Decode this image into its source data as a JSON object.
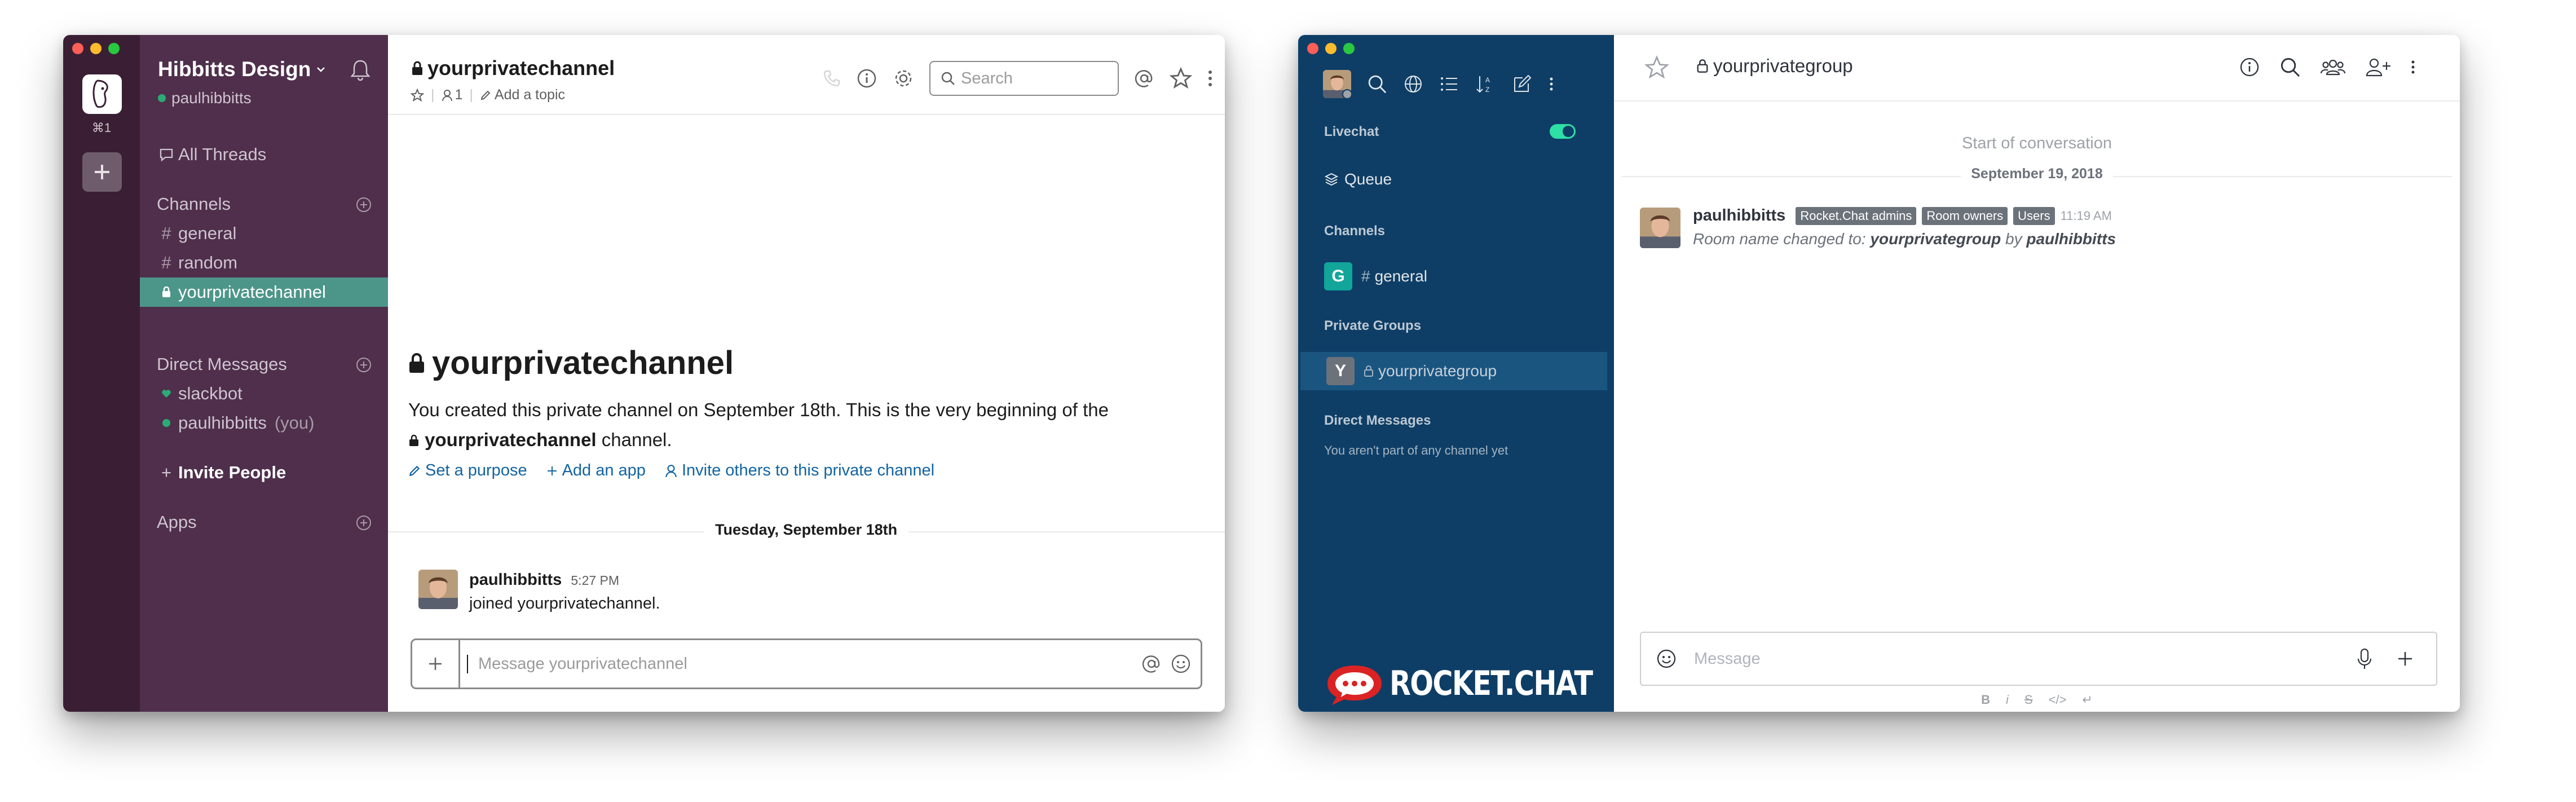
{
  "slack": {
    "workspace_shortcut": "⌘1",
    "team_name": "Hibbitts Design",
    "user_name": "paulhibbitts",
    "all_threads": "All Threads",
    "channels_heading": "Channels",
    "channels": [
      "general",
      "random",
      "yourprivatechannel"
    ],
    "active_channel": "yourprivatechannel",
    "dm_heading": "Direct Messages",
    "dms": [
      {
        "name": "slackbot",
        "suffix": ""
      },
      {
        "name": "paulhibbitts",
        "suffix": "(you)"
      }
    ],
    "invite_people": "Invite People",
    "apps_heading": "Apps",
    "header": {
      "title": "yourprivatechannel",
      "member_count": "1",
      "add_topic": "Add a topic",
      "search_placeholder": "Search"
    },
    "intro": {
      "title": "yourprivatechannel",
      "text_before": "You created this private channel on September 18th. This is the very beginning of the",
      "channel_name": "yourprivatechannel",
      "text_after": "channel."
    },
    "links": {
      "set_purpose": "Set a purpose",
      "add_app": "Add an app",
      "invite_others": "Invite others to this private channel"
    },
    "date_divider": "Tuesday, September 18th",
    "message": {
      "author": "paulhibbitts",
      "time": "5:27 PM",
      "text": "joined yourprivatechannel."
    },
    "composer_placeholder": "Message yourprivatechannel"
  },
  "rocket": {
    "livechat": "Livechat",
    "livechat_enabled": true,
    "queue": "Queue",
    "channels_heading": "Channels",
    "channels": [
      {
        "badge": "G",
        "name": "general",
        "color": "#12a59a"
      }
    ],
    "private_groups_heading": "Private Groups",
    "private_groups": [
      {
        "badge": "Y",
        "name": "yourprivategroup",
        "color": "#6c727a"
      }
    ],
    "dm_heading": "Direct Messages",
    "dm_empty": "You aren't part of any channel yet",
    "logo_text": "ROCKET.CHAT",
    "header": {
      "room_title": "yourprivategroup"
    },
    "start_of_conversation": "Start of conversation",
    "date": "September 19, 2018",
    "message": {
      "author": "paulhibbitts",
      "roles": [
        "Rocket.Chat admins",
        "Room owners",
        "Users"
      ],
      "time": "11:19 AM",
      "text_prefix": "Room name changed to:",
      "room_name": "yourprivategroup",
      "by": "by",
      "user": "paulhibbitts"
    },
    "composer_placeholder": "Message",
    "format_buttons": [
      "B",
      "i",
      "S",
      "</>",
      "↵"
    ]
  },
  "colors": {
    "slack_sidebar": "#4f2f4c",
    "slack_rail": "#3a1f34",
    "slack_active": "#4c9689",
    "slack_link": "#1264a3",
    "rocket_sidebar": "#0e3e66",
    "rocket_active": "#1a5580",
    "rocket_toggle": "#2de0a5"
  }
}
